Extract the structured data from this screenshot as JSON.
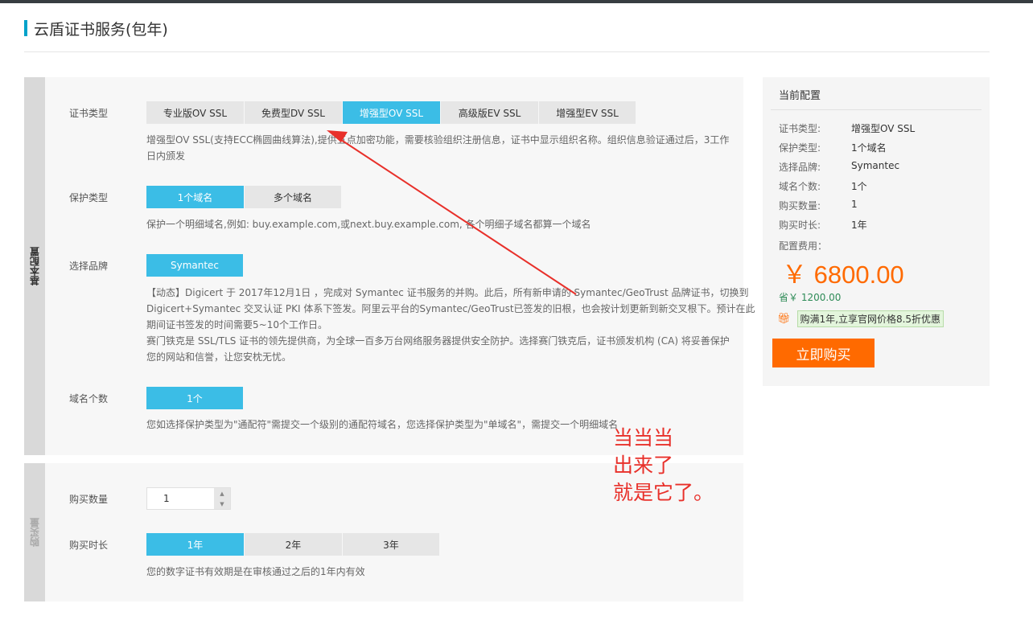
{
  "page_title": "云盾证书服务(包年)",
  "basic": {
    "side_label": "基本配置",
    "cert_type": {
      "label": "证书类型",
      "options": [
        "专业版OV SSL",
        "免费型DV SSL",
        "增强型OV SSL",
        "高级版EV SSL",
        "增强型EV SSL"
      ],
      "selected": "增强型OV SSL",
      "desc_line1": "增强型OV SSL(支持ECC椭圆曲线算法),提供五点加密功能，需要核验组织注册信息，证书中显示组织名称。组织信息验证通过后，3工作",
      "desc_line2": "日内颁发"
    },
    "protect_type": {
      "label": "保护类型",
      "options": [
        "1个域名",
        "多个域名"
      ],
      "selected": "1个域名",
      "desc": "保护一个明细域名,例如: buy.example.com,或next.buy.example.com, 各个明细子域名都算一个域名"
    },
    "brand": {
      "label": "选择品牌",
      "options": [
        "Symantec"
      ],
      "selected": "Symantec",
      "desc_lines": [
        "【动态】Digicert 于 2017年12月1日 ，完成对 Symantec 证书服务的并购。此后，所有新申请的 Symantec/GeoTrust 品牌证书，切换到",
        "Digicert+Symantec 交叉认证 PKI 体系下签发。阿里云平台的Symantec/GeoTrust已签发的旧根，也会按计划更新到新交叉根下。预计在此",
        "期间证书签发的时间需要5~10个工作日。",
        "赛门铁克是 SSL/TLS 证书的领先提供商，为全球一百多万台网络服务器提供安全防护。选择赛门铁克后，证书颁发机构 (CA) 将妥善保护",
        "您的网站和信誉，让您安枕无忧。"
      ]
    },
    "domain_count": {
      "label": "域名个数",
      "options": [
        "1个"
      ],
      "selected": "1个",
      "desc": "您如选择保护类型为\"通配符\"需提交一个级别的通配符域名，您选择保护类型为\"单域名\"，需提交一个明细域名"
    }
  },
  "purchase": {
    "side_label": "购买量",
    "quantity": {
      "label": "购买数量",
      "value": "1"
    },
    "duration": {
      "label": "购买时长",
      "options": [
        "1年",
        "2年",
        "3年"
      ],
      "selected": "1年",
      "desc": "您的数字证书有效期是在审核通过之后的1年内有效"
    }
  },
  "summary": {
    "title": "当前配置",
    "items": [
      {
        "k": "证书类型:",
        "v": "增强型OV SSL"
      },
      {
        "k": "保护类型:",
        "v": "1个域名"
      },
      {
        "k": "选择品牌:",
        "v": "Symantec"
      },
      {
        "k": "域名个数:",
        "v": "1个"
      },
      {
        "k": "购买数量:",
        "v": "1"
      },
      {
        "k": "购买时长:",
        "v": "1年"
      }
    ],
    "fee_label": "配置费用：",
    "price": "￥ 6800.00",
    "save": "省￥ 1200.00",
    "promo": "购满1年,立享官网价格8.5折优惠",
    "buy_label": "立即购买"
  },
  "annotation": {
    "lines": [
      "当当当",
      "出来了",
      "就是它了。"
    ],
    "color": "#e8302a"
  },
  "colors": {
    "accent": "#3bbde6",
    "buy": "#ff6a00",
    "title_bar": "#00a2ca"
  }
}
